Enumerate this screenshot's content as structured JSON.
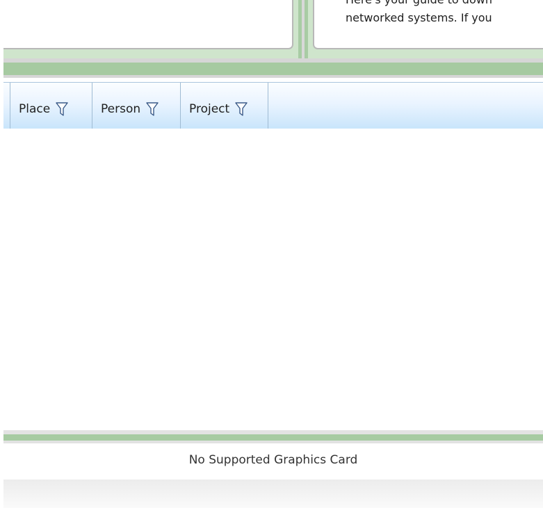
{
  "top_pane": {
    "guide_lines": [
      "Here's your guide to down",
      "networked systems.  If you",
      "                                     "
    ]
  },
  "grid": {
    "columns": [
      {
        "label": "Place",
        "icon": "filter-icon"
      },
      {
        "label": "Person",
        "icon": "filter-icon"
      },
      {
        "label": "Project",
        "icon": "filter-icon"
      }
    ]
  },
  "status": {
    "message": "No Supported Graphics Card"
  },
  "colors": {
    "splitter_green": "#a6caa1",
    "header_blue": "#c9e5fb"
  }
}
